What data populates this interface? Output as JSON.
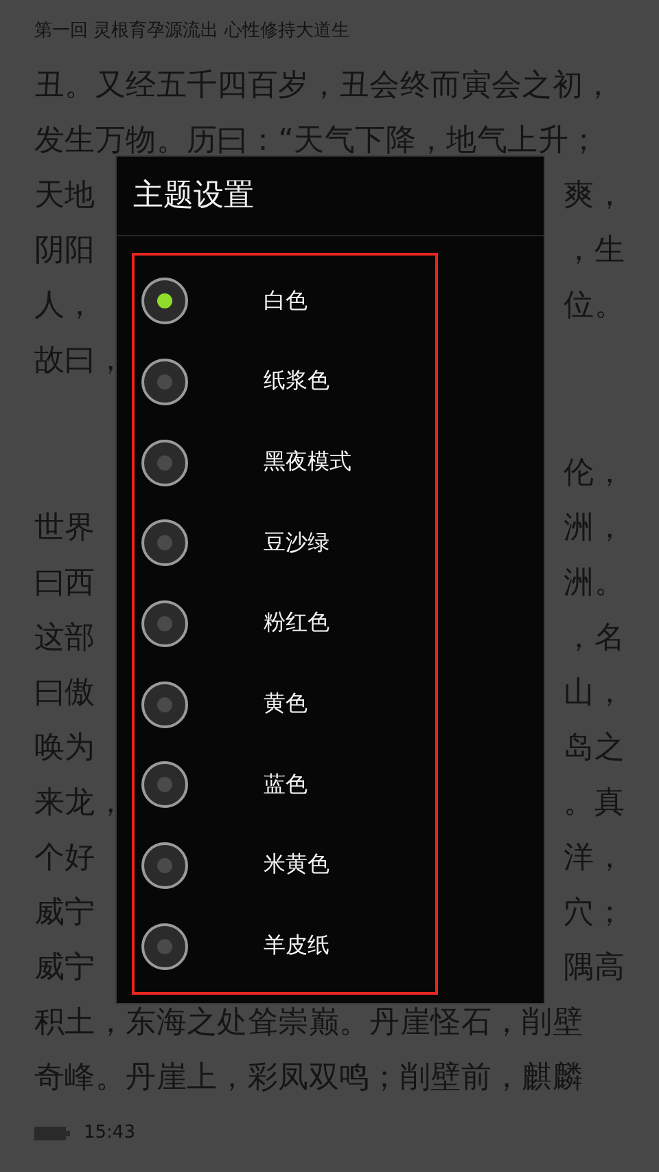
{
  "header": {
    "chapter_title": "第一回 灵根育孕源流出 心性修持大道生"
  },
  "paragraphs": [
    {
      "lines": [
        {
          "kind": "full",
          "text": "丑。又经五千四百岁，丑会终而寅会之初，"
        },
        {
          "kind": "full",
          "text": "发生万物。历曰：“天气下降，地气上升；"
        },
        {
          "kind": "split",
          "left": "天地",
          "right": "爽，"
        },
        {
          "kind": "split",
          "left": "阴阳",
          "right": "，生"
        },
        {
          "kind": "split",
          "left": "人，",
          "right": "位。"
        },
        {
          "kind": "split",
          "left": "故曰，"
        }
      ]
    },
    {
      "lines": [
        {
          "kind": "split",
          "right": "伦，"
        },
        {
          "kind": "split",
          "left": "世界",
          "right": "洲，"
        },
        {
          "kind": "split",
          "left": "曰西",
          "right": "洲。"
        },
        {
          "kind": "split",
          "left": "这部",
          "right": "，名"
        },
        {
          "kind": "split",
          "left": "曰傲",
          "right": "山，"
        },
        {
          "kind": "split",
          "left": "唤为",
          "right": "岛之"
        },
        {
          "kind": "split",
          "left": "来龙，",
          "right": "。真"
        },
        {
          "kind": "split",
          "left": "个好",
          "right": "洋，"
        },
        {
          "kind": "split",
          "left": "威宁",
          "right": "穴；"
        },
        {
          "kind": "split",
          "left": "威宁",
          "right": "隅高"
        },
        {
          "kind": "full",
          "text": "积土，东海之处耸崇巅。丹崖怪石，削壁"
        },
        {
          "kind": "full",
          "text": "奇峰。丹崖上，彩凤双鸣；削壁前，麒麟"
        }
      ]
    }
  ],
  "footer": {
    "time": "15:43"
  },
  "dialog": {
    "title": "主题设置",
    "options": [
      {
        "label": "白色",
        "selected": true
      },
      {
        "label": "纸浆色",
        "selected": false
      },
      {
        "label": "黑夜模式",
        "selected": false
      },
      {
        "label": "豆沙绿",
        "selected": false
      },
      {
        "label": "粉红色",
        "selected": false
      },
      {
        "label": "黄色",
        "selected": false
      },
      {
        "label": "蓝色",
        "selected": false
      },
      {
        "label": "米黄色",
        "selected": false
      },
      {
        "label": "羊皮纸",
        "selected": false
      }
    ]
  }
}
